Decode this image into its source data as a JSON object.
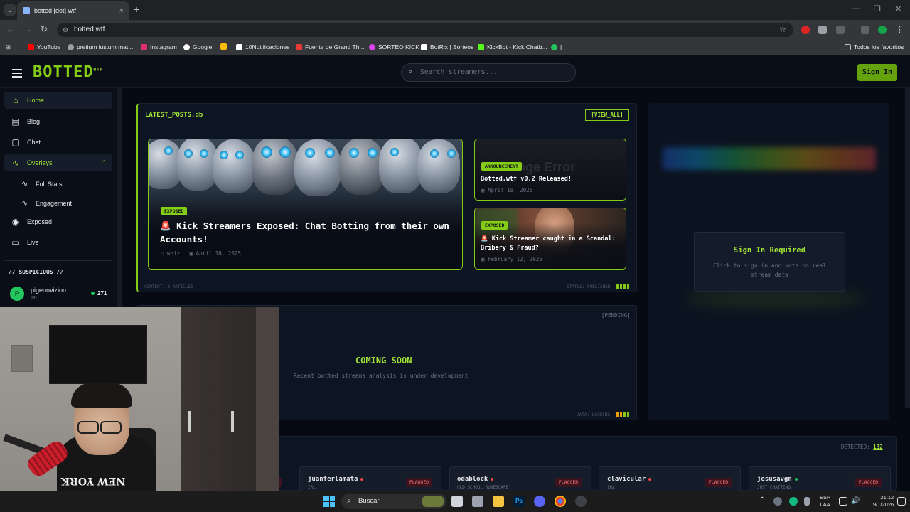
{
  "browser": {
    "tab_title": "botted [dot] wtf",
    "url": "botted.wtf",
    "bookmarks": [
      {
        "label": "YouTube",
        "color": "#ff0000"
      },
      {
        "label": "pretium iustum mat...",
        "color": "#9aa0a6"
      },
      {
        "label": "Instagram",
        "color": "#e1306c"
      },
      {
        "label": "Google",
        "color": "#ffffff"
      },
      {
        "label": "",
        "color": "#fbbc05"
      },
      {
        "label": "10Notificaciones",
        "color": "#ffffff"
      },
      {
        "label": "Fuente de Grand Th...",
        "color": "#e53935"
      },
      {
        "label": "SORTEO KICK",
        "color": "#d946ef"
      },
      {
        "label": "BotRix | Sorteos",
        "color": "#ffffff"
      },
      {
        "label": "KickBot - Kick Chatb...",
        "color": "#53fc18"
      },
      {
        "label": "|",
        "color": "#22c55e"
      }
    ],
    "all_bookmarks": "Todos los favoritos"
  },
  "header": {
    "logo": "BOTTED",
    "logo_sup": "WTF",
    "search_placeholder": "Search streamers...",
    "signin": "Sign In"
  },
  "sidebar": {
    "items": [
      {
        "label": "Home",
        "icon": "home-icon"
      },
      {
        "label": "Blog",
        "icon": "blog-icon"
      },
      {
        "label": "Chat",
        "icon": "chat-icon"
      },
      {
        "label": "Overlays",
        "icon": "activity-icon"
      },
      {
        "label": "Full Stats",
        "icon": "activity-icon"
      },
      {
        "label": "Engagement",
        "icon": "activity-icon"
      },
      {
        "label": "Exposed",
        "icon": "eye-icon"
      },
      {
        "label": "Live",
        "icon": "tv-icon"
      }
    ],
    "suspicious_title": "// SUSPICIOUS //",
    "suspicious_user": {
      "initial": "P",
      "name": "pigeonvizion",
      "category": "IRL",
      "count": "271"
    }
  },
  "posts": {
    "title": "LATEST_POSTS.db",
    "view_all": "[VIEW_ALL]",
    "featured": {
      "badge": "EXPOSED",
      "title": "🚨 Kick Streamers Exposed: Chat Botting from their own Accounts!",
      "author": "whiz",
      "date": "April 18, 2025"
    },
    "side": [
      {
        "badge": "ANNOUNCEMENT",
        "title": "Botted.wtf v0.2 Released!",
        "date": "April 18, 2025"
      },
      {
        "badge": "EXPOSED",
        "title": "🚨 Kick Streamer caught in a Scandal: Bribery & Fraud?",
        "date": "February 12, 2025"
      }
    ],
    "footer_left": "CONTENT: 3 ARTICLES",
    "footer_right": "STATUS: PUBLISHED"
  },
  "soon": {
    "pending": "[PENDING]",
    "title": "COMING SOON",
    "subtitle": "Recent botted streams analysis is under development",
    "footer": "DATA: LOADING"
  },
  "right_panel": {
    "title": "Sign In Required",
    "subtitle": "Click to sign in and vote on real stream data"
  },
  "detected": {
    "label": "DETECTED:",
    "count": "132",
    "cards": [
      {
        "name": "juanferlamata",
        "category": "IRL",
        "flag": "FLAGGED"
      },
      {
        "name": "odablock",
        "category": "OLD SCHOOL RUNESCAPE",
        "flag": "FLAGGED"
      },
      {
        "name": "clavicular",
        "category": "IRL",
        "flag": "FLAGGED"
      },
      {
        "name": "jesusavgn",
        "category": "JUST CHATTING",
        "flag": "FLAGGED"
      }
    ],
    "partial_flag": "FLAGGED"
  },
  "taskbar": {
    "search": "Buscar",
    "lang_top": "ESP",
    "lang_bottom": "LAA",
    "time": "21:12",
    "date": "9/1/2026"
  }
}
